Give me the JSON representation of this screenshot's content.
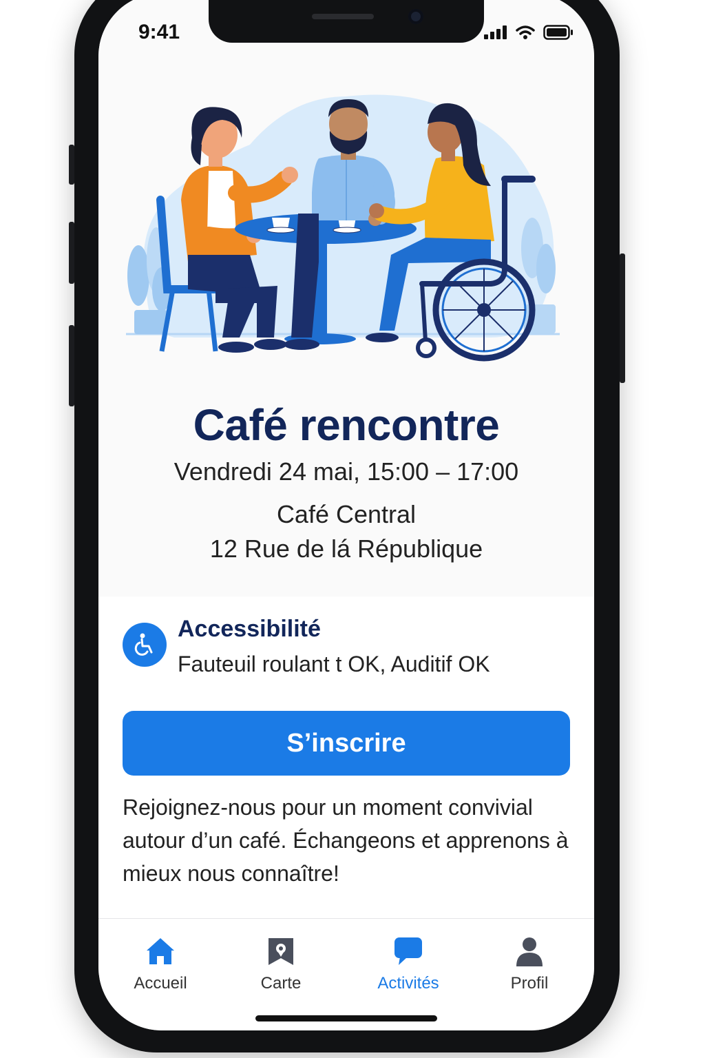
{
  "colors": {
    "accent": "#1b7be6",
    "title": "#12265a",
    "text": "#222222"
  },
  "status_bar": {
    "time": "9:41",
    "icons": [
      "signal-icon",
      "wifi-icon",
      "battery-icon"
    ]
  },
  "event": {
    "title": "Café rencontre",
    "datetime": "Vendredi 24 mai, 15:00 – 17:00",
    "place": "Café Central",
    "address": "12 Rue de lá République"
  },
  "accessibility": {
    "icon": "wheelchair-icon",
    "title": "Accessibilité",
    "description": "Fauteuil roulant t OK, Auditif OK"
  },
  "cta": {
    "label": "S’inscrire"
  },
  "description": "Rejoignez-nous pour un moment convivial autour d’un café. Échangeons et apprenons à mieux nous connaître!",
  "tabbar": {
    "active": "Activités",
    "items": [
      {
        "label": "Accueil",
        "icon": "home-icon"
      },
      {
        "label": "Carte",
        "icon": "map-pin-icon"
      },
      {
        "label": "Activités",
        "icon": "chat-bubble-icon"
      },
      {
        "label": "Profil",
        "icon": "person-icon"
      }
    ]
  }
}
